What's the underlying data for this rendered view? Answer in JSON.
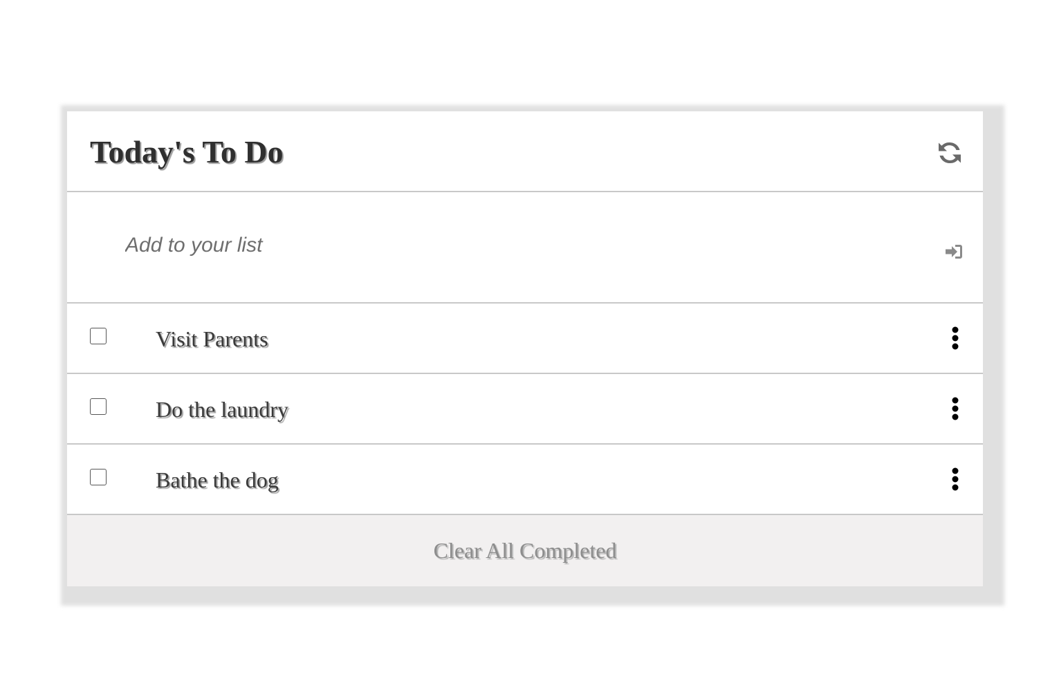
{
  "header": {
    "title": "Today's To Do",
    "refresh_icon": "refresh-icon"
  },
  "add": {
    "placeholder": "Add to your list",
    "value": "",
    "submit_icon": "sign-in-icon"
  },
  "tasks": [
    {
      "label": "Visit Parents",
      "checked": false
    },
    {
      "label": "Do the laundry",
      "checked": false
    },
    {
      "label": "Bathe the dog",
      "checked": false
    }
  ],
  "footer": {
    "clear_label": "Clear All Completed"
  },
  "colors": {
    "page_bg": "#ffffff",
    "card_shadow": "#e0e0e0",
    "divider": "#c8c8c8",
    "footer_bg": "#f2f0f0",
    "title_text": "#2f2f2f",
    "footer_text": "#8d8d8d"
  }
}
